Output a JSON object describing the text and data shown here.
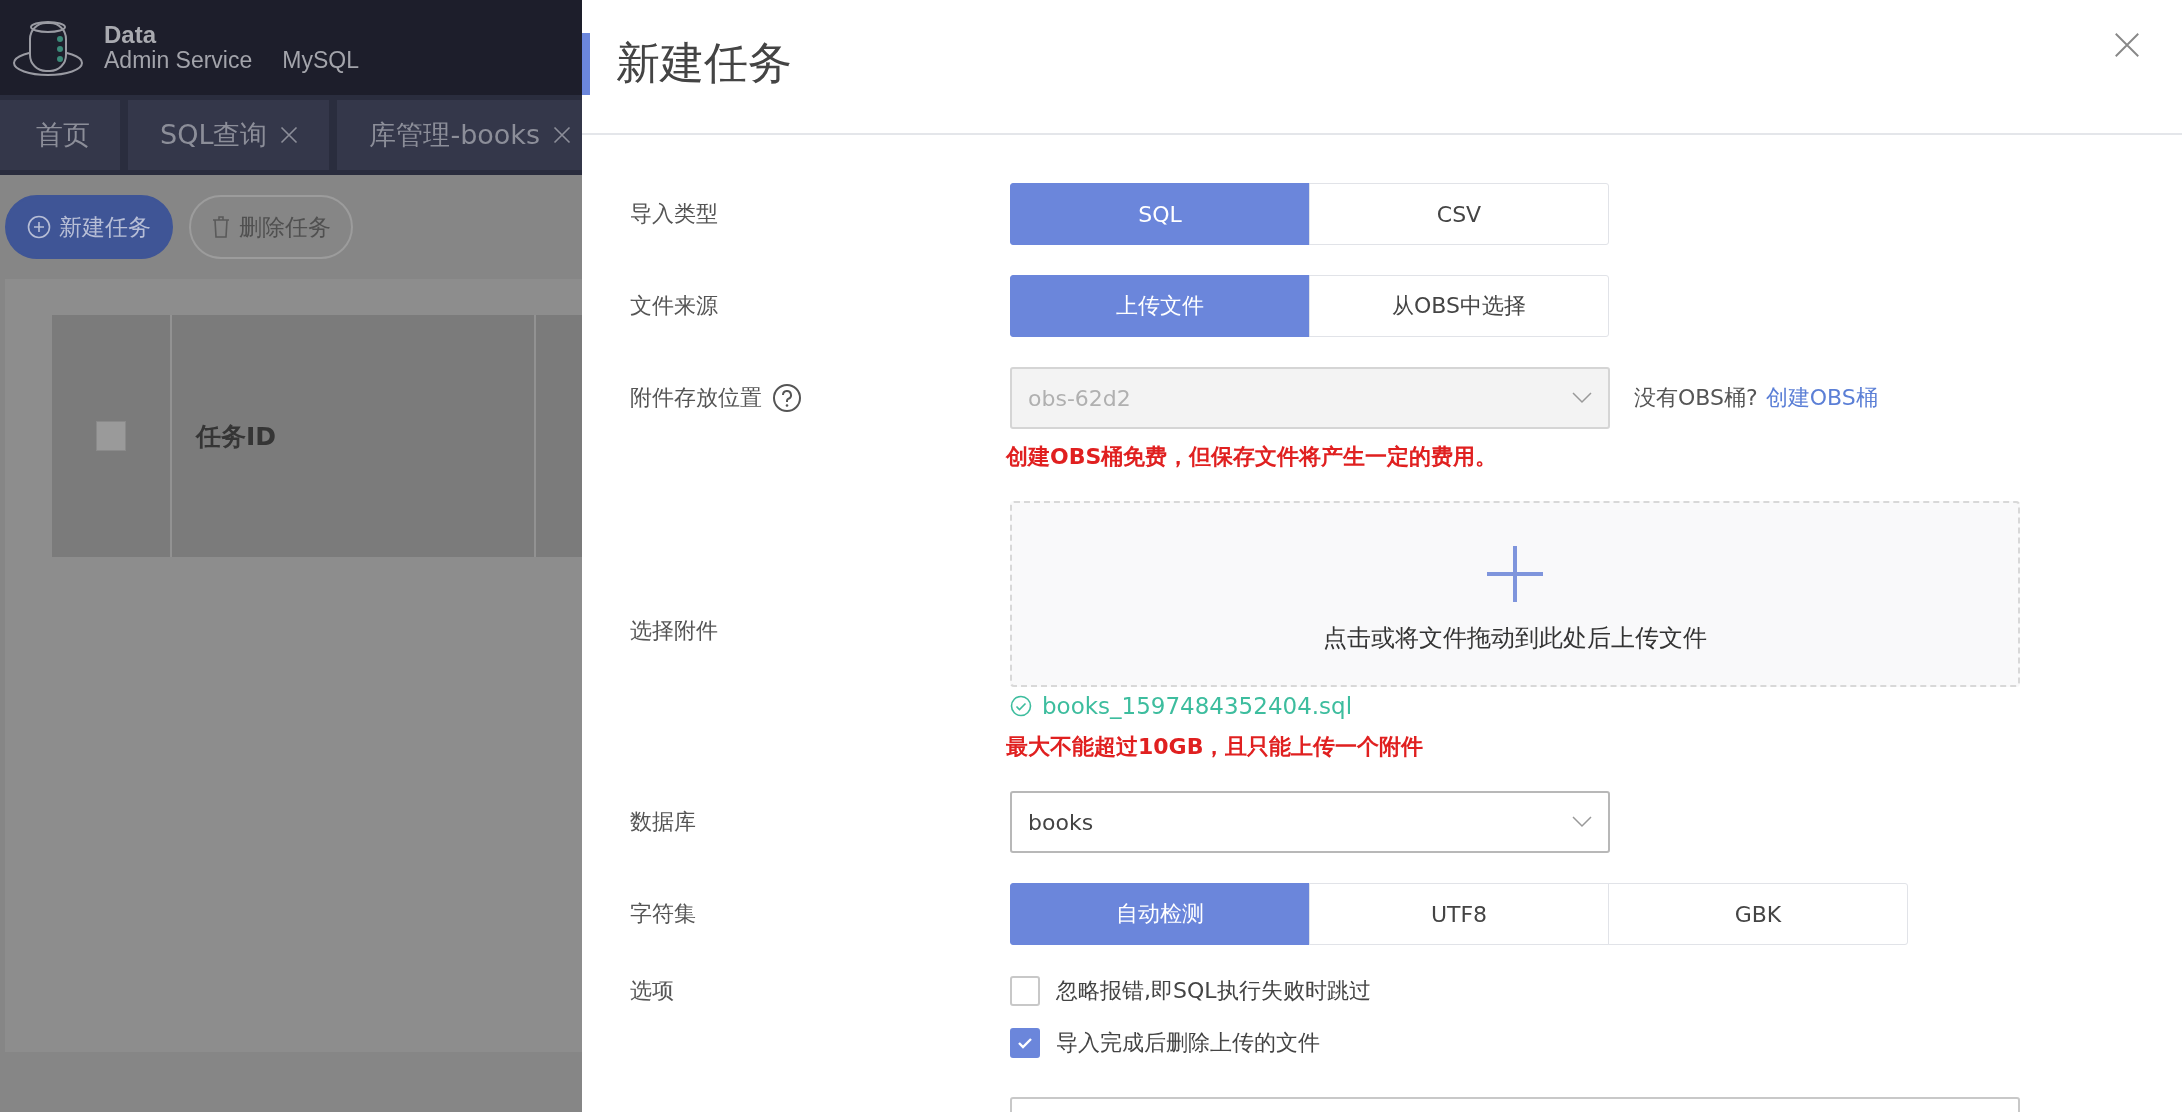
{
  "app": {
    "logo": {
      "title": "Data",
      "subtitle": "Admin Service",
      "engine": "MySQL"
    },
    "tabs": [
      {
        "label": "首页",
        "closable": false
      },
      {
        "label": "SQL查询",
        "closable": true
      },
      {
        "label": "库管理-books",
        "closable": true
      }
    ],
    "toolbar": [
      {
        "label": "新建任务",
        "kind": "primary"
      },
      {
        "label": "删除任务",
        "kind": "default"
      }
    ],
    "table": {
      "select_all_checked": false,
      "columns": [
        "任务ID"
      ]
    }
  },
  "dialog": {
    "title": "新建任务",
    "fields": [
      {
        "kind": "segmented",
        "label": "导入类型",
        "options": [
          {
            "label": "SQL",
            "selected": true
          },
          {
            "label": "CSV",
            "selected": false
          }
        ]
      },
      {
        "kind": "segmented",
        "label": "文件来源",
        "options": [
          {
            "label": "上传文件",
            "selected": true
          },
          {
            "label": "从OBS中选择",
            "selected": false
          }
        ]
      },
      {
        "kind": "select",
        "label": "附件存放位置",
        "help": true,
        "value": "obs-62d2",
        "disabled": true,
        "aside": "没有OBS桶?",
        "link": "创建OBS桶",
        "note": "创建OBS桶免费，但保存文件将产生一定的费用。"
      },
      {
        "kind": "upload",
        "label": "选择附件",
        "hint": "点击或将文件拖动到此处后上传文件",
        "files": [
          "books_1597484352404.sql"
        ],
        "note": "最大不能超过10GB，且只能上传一个附件"
      },
      {
        "kind": "select",
        "label": "数据库",
        "value": "books",
        "disabled": false
      },
      {
        "kind": "segmented",
        "label": "字符集",
        "options": [
          {
            "label": "自动检测",
            "selected": true
          },
          {
            "label": "UTF8",
            "selected": false
          },
          {
            "label": "GBK",
            "selected": false
          }
        ]
      },
      {
        "kind": "checkboxes",
        "label": "选项",
        "options": [
          {
            "label": "忽略报错,即SQL执行失败时跳过",
            "checked": false
          },
          {
            "label": "导入完成后删除上传的文件",
            "checked": true
          }
        ]
      },
      {
        "kind": "input"
      }
    ]
  }
}
